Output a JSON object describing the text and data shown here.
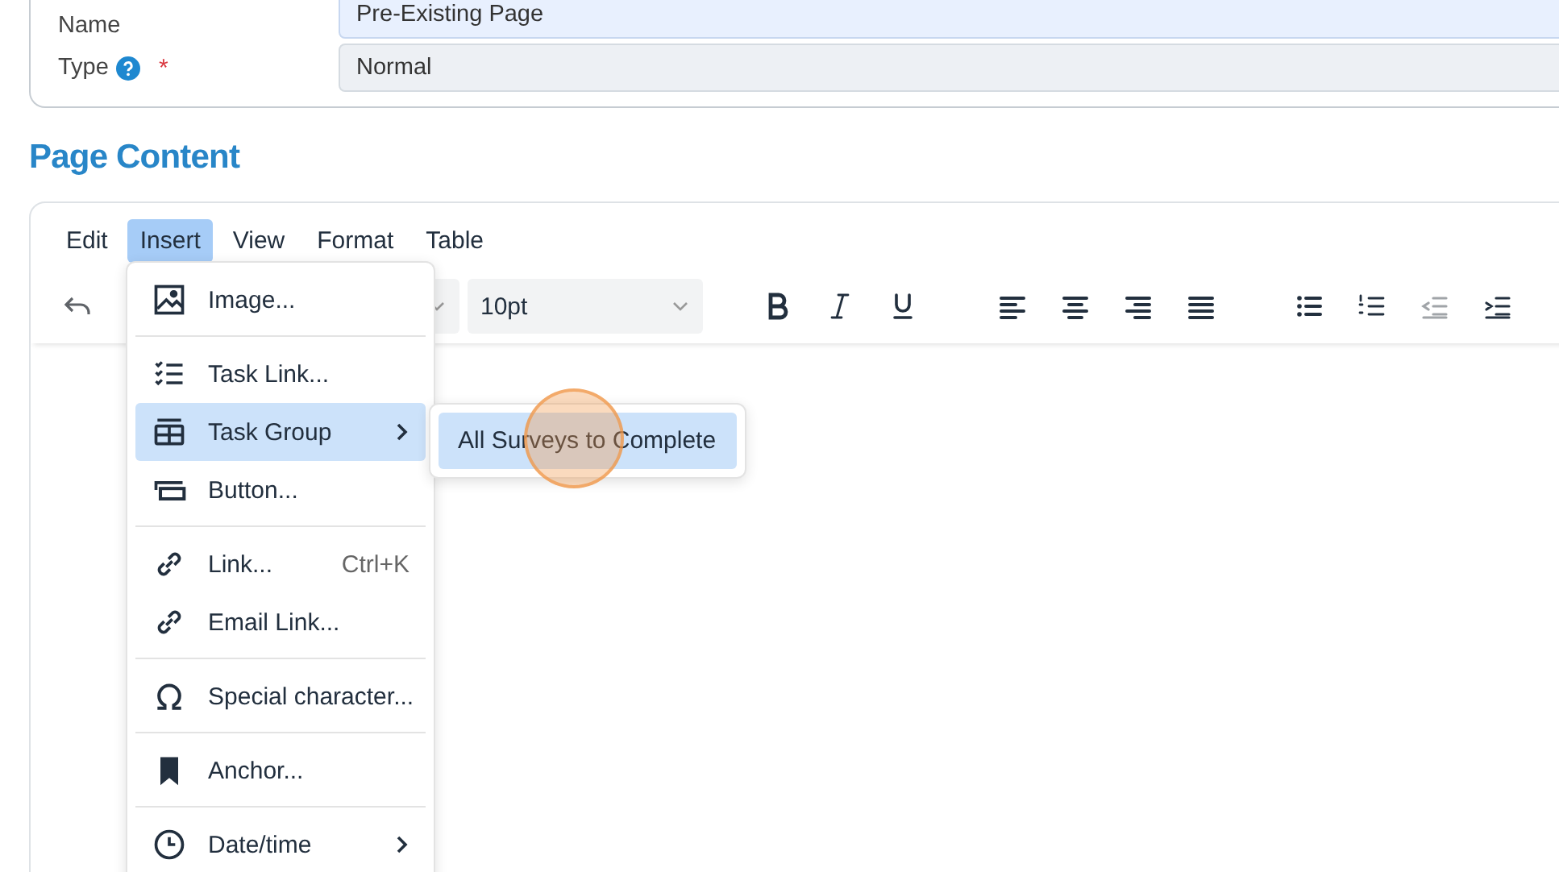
{
  "form": {
    "fields": [
      {
        "label": "Name",
        "value": "Pre-Existing Page",
        "help": false,
        "required": false,
        "focused": true
      },
      {
        "label": "Type",
        "value": "Normal",
        "help": true,
        "required": true,
        "focused": false
      }
    ]
  },
  "required_mark": "*",
  "section_title": "Page Content",
  "editor": {
    "menubar": [
      {
        "label": "Edit",
        "selected": false
      },
      {
        "label": "Insert",
        "selected": true
      },
      {
        "label": "View",
        "selected": false
      },
      {
        "label": "Format",
        "selected": false
      },
      {
        "label": "Table",
        "selected": false
      }
    ],
    "font_size": "10pt",
    "toolbar_groups": [
      [
        {
          "disabled": false
        },
        {
          "disabled": false
        },
        {
          "disabled": false
        }
      ],
      [
        {
          "disabled": false
        },
        {
          "disabled": false
        },
        {
          "disabled": false
        },
        {
          "disabled": false
        }
      ],
      [
        {
          "disabled": false
        },
        {
          "disabled": false
        },
        {
          "disabled": true
        },
        {
          "disabled": false
        }
      ]
    ]
  },
  "insert_menu": {
    "groups": [
      [
        {
          "label": "Image...",
          "selected": false,
          "submenu": false
        }
      ],
      [
        {
          "label": "Task Link...",
          "selected": false,
          "submenu": false
        },
        {
          "label": "Task Group",
          "selected": true,
          "submenu": true
        },
        {
          "label": "Button...",
          "selected": false,
          "submenu": false
        }
      ],
      [
        {
          "label": "Link...",
          "shortcut": "Ctrl+K",
          "selected": false,
          "submenu": false
        },
        {
          "label": "Email Link...",
          "selected": false,
          "submenu": false
        }
      ],
      [
        {
          "label": "Special character...",
          "selected": false,
          "submenu": false
        }
      ],
      [
        {
          "label": "Anchor...",
          "selected": false,
          "submenu": false
        }
      ],
      [
        {
          "label": "Date/time",
          "selected": false,
          "submenu": true
        }
      ]
    ]
  },
  "submenu": {
    "items": [
      {
        "label": "All Surveys to Complete",
        "selected": true
      }
    ]
  }
}
